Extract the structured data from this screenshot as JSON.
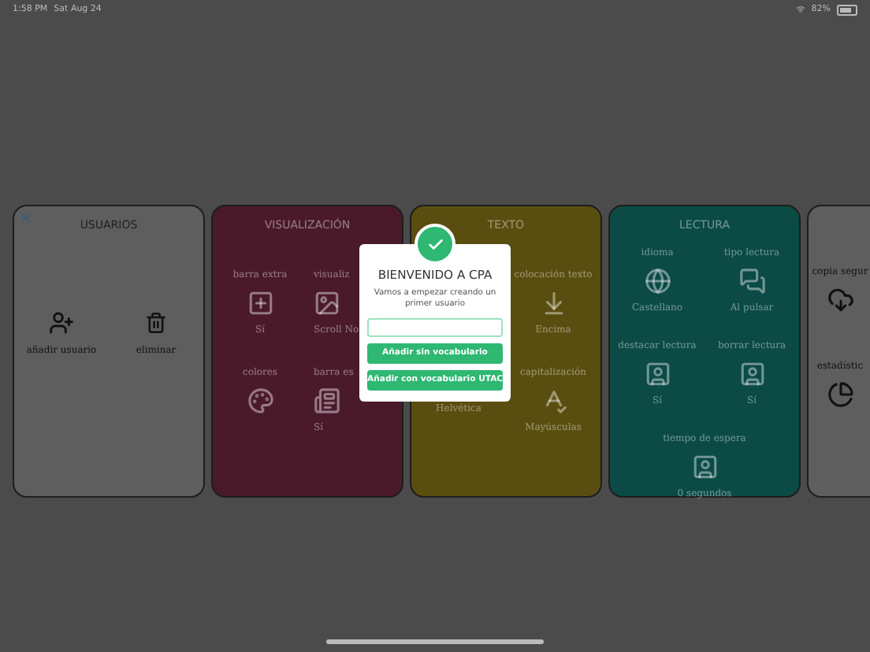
{
  "status_bar": {
    "time": "1:58 PM",
    "date": "Sat Aug 24",
    "battery": "82%"
  },
  "cards": [
    {
      "title": "USUARIOS",
      "kind": "plain",
      "color": "#5e5e5e",
      "closable": true,
      "rows": [
        [
          {
            "label": "añadir usuario"
          },
          {
            "label": "eliminar"
          }
        ]
      ]
    },
    {
      "title": "VISUALIZACIÓN",
      "kind": "colored",
      "color": "#4a1a2b",
      "closable": false,
      "rows": [
        [
          {
            "label": "barra extra",
            "value": "Sí"
          },
          {
            "label": "visualiz",
            "value": "Scroll No"
          }
        ],
        [
          {
            "label": "colores"
          },
          {
            "label": "barra es",
            "value": "Sí"
          }
        ]
      ]
    },
    {
      "title": "TEXTO",
      "kind": "colored",
      "color": "#5a4d10",
      "closable": false,
      "rows": [
        [
          null,
          {
            "label": "colocación texto",
            "value": "Encima"
          }
        ],
        [
          {
            "value": "Helvética"
          },
          {
            "label": "capitalización",
            "value": "Mayúsculas"
          }
        ]
      ]
    },
    {
      "title": "LECTURA",
      "kind": "colored",
      "color": "#0b4a45",
      "closable": false,
      "rows": [
        [
          {
            "label": "idioma",
            "value": "Castellano"
          },
          {
            "label": "tipo lectura",
            "value": "Al pulsar"
          }
        ],
        [
          {
            "label": "destacar lectura",
            "value": "Sí"
          },
          {
            "label": "borrar lectura",
            "value": "Sí"
          }
        ],
        [
          {
            "label": "tiempo de espera",
            "value": "0 segundos"
          }
        ]
      ]
    },
    {
      "kind": "plain",
      "color": "#5e5e5e",
      "closable": false,
      "rows": [
        [
          {
            "label": "copia segur"
          }
        ],
        [
          {
            "label": "estadístic"
          }
        ]
      ]
    }
  ],
  "dialog": {
    "title": "BIENVENIDO A CPA",
    "message": "Vamos a empezar creando un primer usuario",
    "buttons": [
      "Añadir sin vocabulario",
      "Añadir con vocabulario UTAC"
    ]
  }
}
